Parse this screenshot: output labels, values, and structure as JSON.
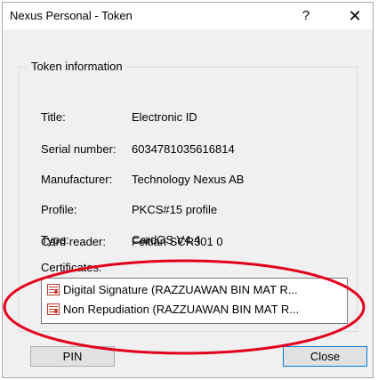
{
  "window": {
    "title": "Nexus Personal - Token",
    "help_glyph": "?",
    "close_glyph": "✕"
  },
  "token_info": {
    "legend": "Token information",
    "fields": [
      {
        "label": "Title:",
        "value": "Electronic ID"
      },
      {
        "label": "Serial number:",
        "value": "6034781035616814"
      },
      {
        "label": "Manufacturer:",
        "value": "Technology Nexus AB"
      },
      {
        "label": "Profile:",
        "value": "PKCS#15 profile"
      },
      {
        "label": "Type:",
        "value": "CardOS V4.4"
      },
      {
        "label": "Card reader:",
        "value": "Feitian SCR301 0"
      }
    ],
    "certificates_label": "Certificates:",
    "certificates": [
      "Digital Signature (RAZZUAWAN BIN MAT R...",
      "Non Repudiation (RAZZUAWAN BIN MAT R..."
    ]
  },
  "buttons": {
    "pin": "PIN",
    "close": "Close"
  },
  "colors": {
    "annotation": "#e3001b",
    "focus_border": "#0078d7"
  }
}
